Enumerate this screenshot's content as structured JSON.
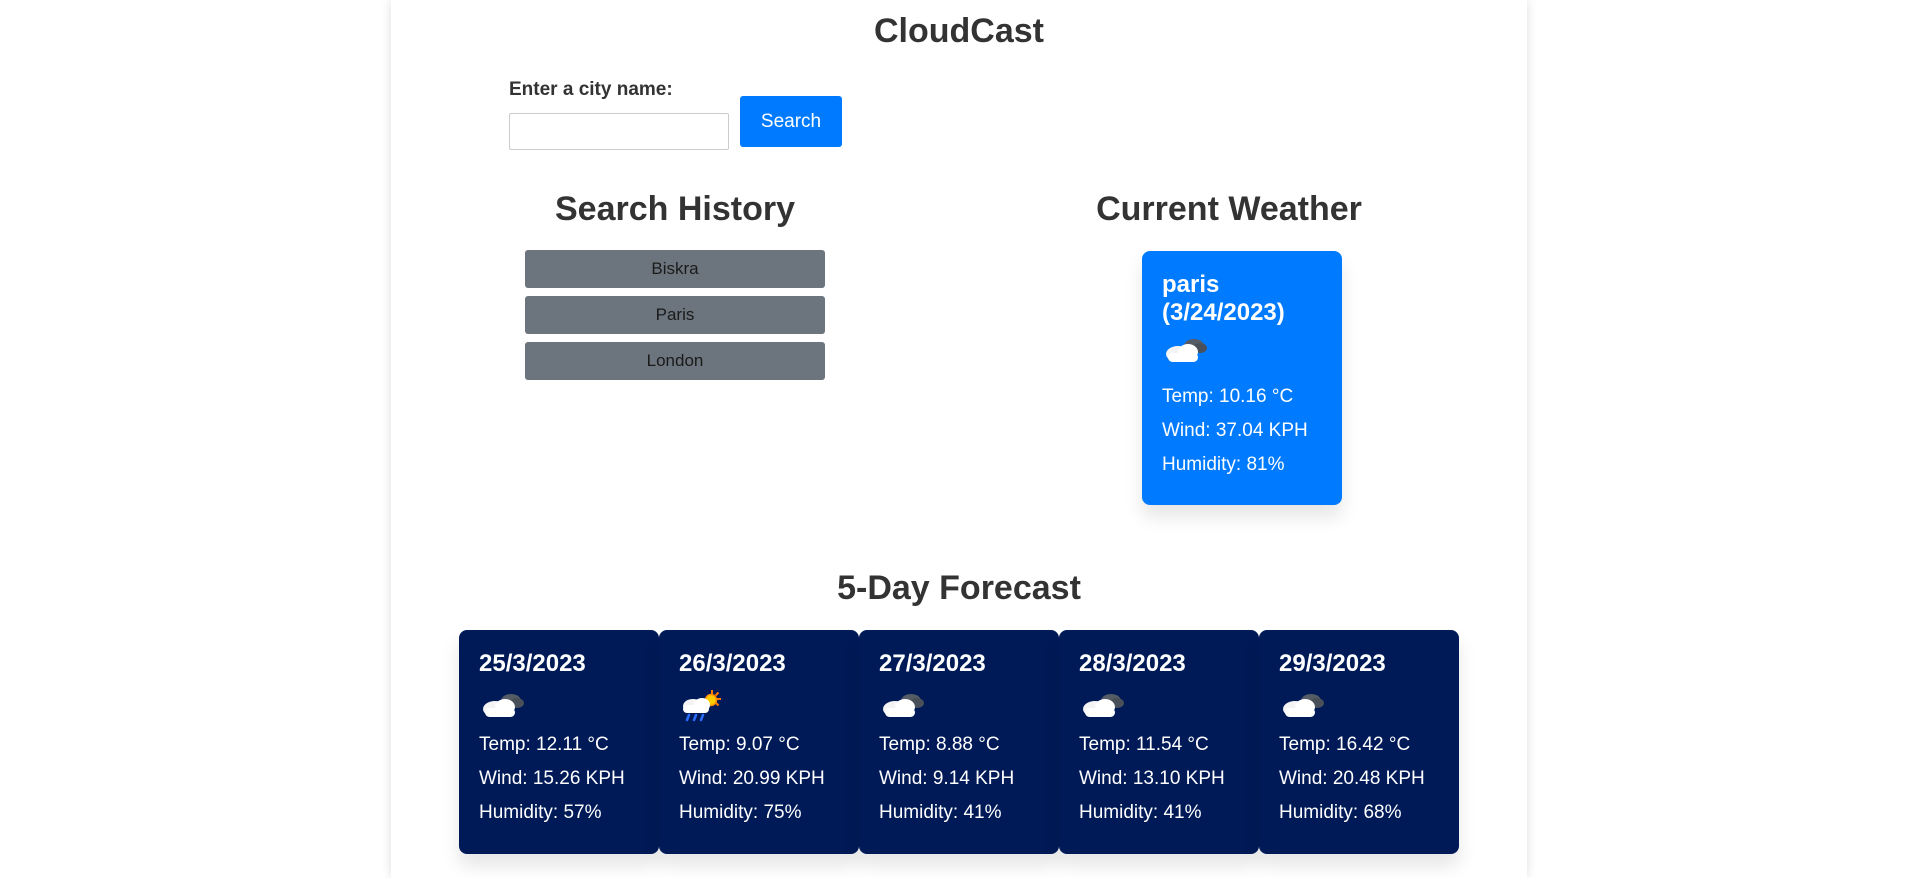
{
  "app": {
    "title": "CloudCast"
  },
  "search": {
    "label": "Enter a city name:",
    "input_value": "",
    "button_label": "Search"
  },
  "history": {
    "title": "Search History",
    "items": [
      {
        "label": "Biskra"
      },
      {
        "label": "Paris"
      },
      {
        "label": "London"
      }
    ]
  },
  "current": {
    "title": "Current Weather",
    "city": "paris",
    "date": "(3/24/2023)",
    "icon": "cloudy-icon",
    "temp": "Temp: 10.16 °C",
    "wind": "Wind: 37.04 KPH",
    "humidity": "Humidity: 81%"
  },
  "forecast": {
    "title": "5-Day Forecast",
    "days": [
      {
        "date": "25/3/2023",
        "icon": "cloudy-icon",
        "temp": "Temp: 12.11 °C",
        "wind": "Wind: 15.26 KPH",
        "humidity": "Humidity: 57%"
      },
      {
        "date": "26/3/2023",
        "icon": "rain-sun-icon",
        "temp": "Temp: 9.07 °C",
        "wind": "Wind: 20.99 KPH",
        "humidity": "Humidity: 75%"
      },
      {
        "date": "27/3/2023",
        "icon": "cloudy-icon",
        "temp": "Temp: 8.88 °C",
        "wind": "Wind: 9.14 KPH",
        "humidity": "Humidity: 41%"
      },
      {
        "date": "28/3/2023",
        "icon": "cloudy-icon",
        "temp": "Temp: 11.54 °C",
        "wind": "Wind: 13.10 KPH",
        "humidity": "Humidity: 41%"
      },
      {
        "date": "29/3/2023",
        "icon": "cloudy-icon",
        "temp": "Temp: 16.42 °C",
        "wind": "Wind: 20.48 KPH",
        "humidity": "Humidity: 68%"
      }
    ]
  },
  "colors": {
    "primary": "#007bff",
    "history_button": "#6c757d",
    "forecast_card": "#001a57"
  }
}
